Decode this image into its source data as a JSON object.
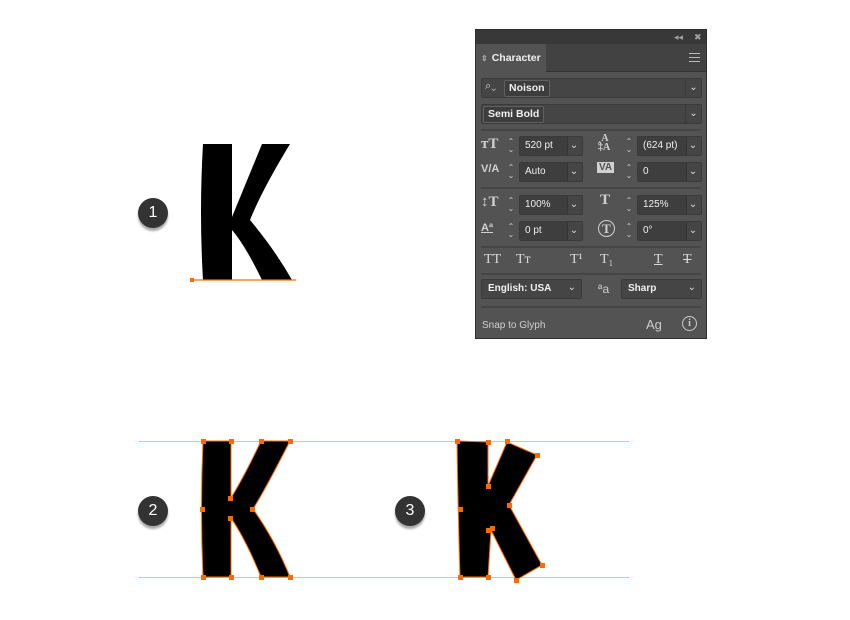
{
  "steps": [
    {
      "number": "1"
    },
    {
      "number": "2"
    },
    {
      "number": "3"
    }
  ],
  "colors": {
    "anchor": "#ff6a00",
    "guide": "#5ff3f3",
    "glyph": "#000000",
    "panel_bg": "#535353"
  },
  "panel": {
    "title_bar": {
      "collapse_icon": "double-chevron-left-icon",
      "close_icon": "close-icon"
    },
    "tab_label": "Character",
    "menu_icon": "hamburger-menu-icon",
    "font_family": {
      "search_icon": "search-icon",
      "value": "Noison"
    },
    "font_style": {
      "value": "Semi Bold"
    },
    "font_size": {
      "icon": "font-size-icon",
      "value": "520 pt"
    },
    "leading": {
      "icon": "leading-icon",
      "value": "(624 pt)"
    },
    "kerning": {
      "icon": "kerning-icon",
      "value": "Auto"
    },
    "tracking": {
      "icon": "tracking-icon",
      "value": "0"
    },
    "vertical_scale": {
      "icon": "vertical-scale-icon",
      "value": "100%"
    },
    "horizontal_scale": {
      "icon": "horizontal-scale-icon",
      "value": "125%"
    },
    "baseline_shift": {
      "icon": "baseline-shift-icon",
      "value": "0 pt"
    },
    "rotation": {
      "icon": "character-rotation-icon",
      "value": "0°"
    },
    "text_buttons": [
      {
        "name": "all-caps",
        "label": "TT"
      },
      {
        "name": "small-caps",
        "label": "Tт"
      },
      {
        "name": "superscript",
        "label": "T¹"
      },
      {
        "name": "subscript",
        "label": "T₁"
      },
      {
        "name": "underline",
        "label": "T"
      },
      {
        "name": "strikethrough",
        "label": "T"
      }
    ],
    "language": {
      "value": "English: USA"
    },
    "antialiasing": {
      "icon": "antialiasing-icon",
      "label": "ªa",
      "value": "Sharp"
    },
    "snap_to_glyph": {
      "label": "Snap to Glyph",
      "glyph_icon": "snap-glyph-icon",
      "glyph_label": "Ag",
      "info_icon": "info-icon"
    }
  }
}
